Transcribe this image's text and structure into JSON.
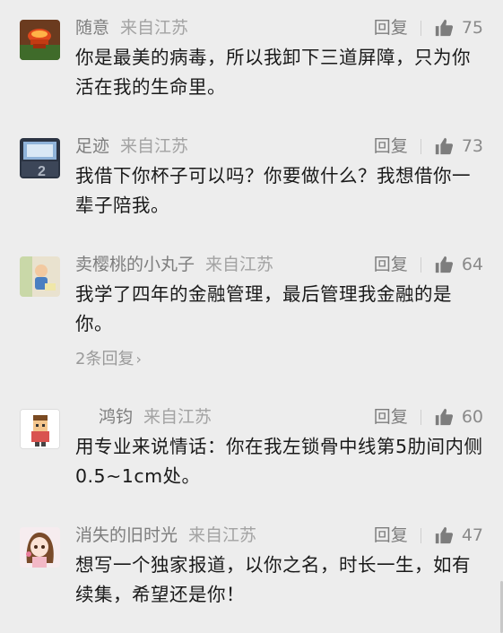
{
  "comments": [
    {
      "nickname": "随意",
      "location": "来自江苏",
      "reply_label": "回复",
      "likes": "75",
      "text": "你是最美的病毒，所以我卸下三道屏障，只为你活在我的生命里。"
    },
    {
      "nickname": "足迹",
      "location": "来自江苏",
      "reply_label": "回复",
      "likes": "73",
      "text": "我借下你杯子可以吗？你要做什么？我想借你一辈子陪我。"
    },
    {
      "nickname": "卖樱桃的小丸子",
      "location": "来自江苏",
      "reply_label": "回复",
      "likes": "64",
      "text": "我学了四年的金融管理，最后管理我金融的是你。",
      "replies_label": "2条回复",
      "replies_chevron": "›"
    },
    {
      "nickname": "鸿钧",
      "location": "来自江苏",
      "reply_label": "回复",
      "likes": "60",
      "text": "用专业来说情话：你在我左锁骨中线第5肋间内侧0.5~1cm处。"
    },
    {
      "nickname": "消失的旧时光",
      "location": "来自江苏",
      "reply_label": "回复",
      "likes": "47",
      "text": "想写一个独家报道，以你之名，时长一生，如有续集，希望还是你！"
    }
  ],
  "icons": {
    "like": "thumbs-up-icon"
  },
  "colors": {
    "background": "#ededed",
    "text": "#1a1a1a",
    "meta": "#8a8a8a",
    "like_icon": "#7d7d7d"
  }
}
